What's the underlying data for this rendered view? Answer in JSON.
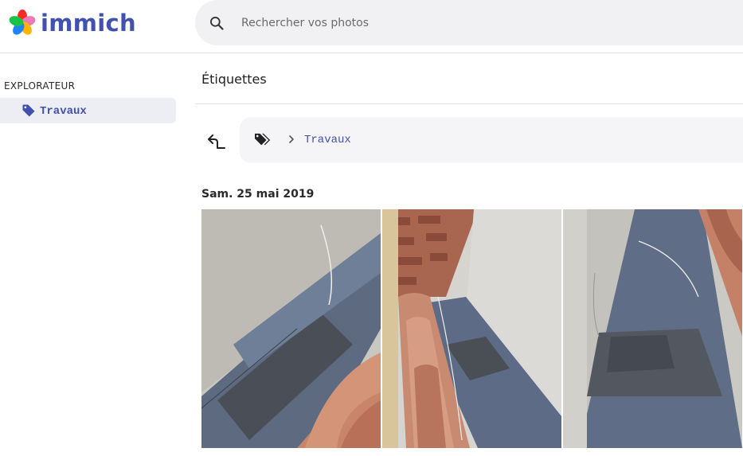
{
  "app": {
    "name": "immich",
    "brand_color": "#4250af"
  },
  "search": {
    "placeholder": "Rechercher vos photos",
    "value": "",
    "icon": "search-icon"
  },
  "sidebar": {
    "heading": "EXPLORATEUR",
    "items": [
      {
        "label": "Travaux",
        "icon": "tag-icon",
        "active": true
      }
    ]
  },
  "main": {
    "title": "Étiquettes",
    "up_icon": "up-arrow-icon",
    "breadcrumb": {
      "root_icon": "tags-icon",
      "separator_icon": "chevron-right-icon",
      "items": [
        "Travaux"
      ]
    },
    "groups": [
      {
        "date": "Sam. 25 mai 2019",
        "photos": [
          {
            "subject": "roof-gutter-photo"
          },
          {
            "subject": "roof-tiles-photo"
          },
          {
            "subject": "roof-ridge-photo"
          }
        ]
      }
    ]
  }
}
